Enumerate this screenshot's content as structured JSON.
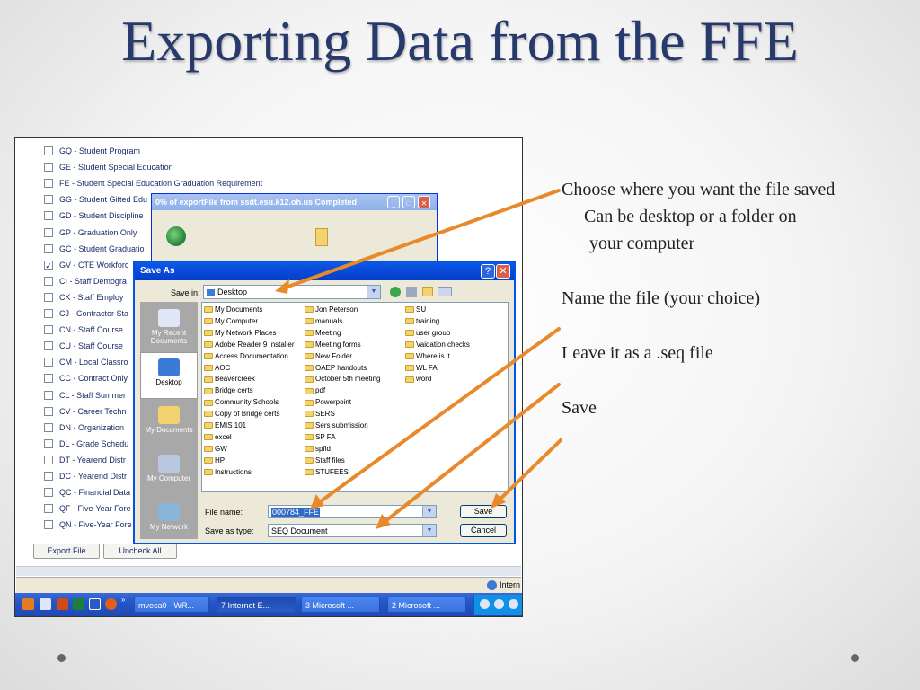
{
  "slide": {
    "title": "Exporting Data from the FFE",
    "bullets": {
      "b1": "Choose where you want the file saved",
      "b1a": "Can be desktop or a folder on",
      "b1b": "your computer",
      "b2": "Name the file (your choice)",
      "b3": "Leave it as a .seq file",
      "b4": "Save"
    },
    "accent_color": "#e8892b"
  },
  "background_list": {
    "items": [
      {
        "label": "GQ - Student Program",
        "checked": false
      },
      {
        "label": "GE - Student Special Education",
        "checked": false
      },
      {
        "label": "FE - Student Special Education Graduation Requirement",
        "checked": false
      },
      {
        "label": "GG - Student Gifted Edu",
        "checked": false
      },
      {
        "label": "GD - Student Discipline",
        "checked": false
      },
      {
        "label": "GP - Graduation Only",
        "checked": false
      },
      {
        "label": "GC - Student Graduatio",
        "checked": false
      },
      {
        "label": "GV - CTE Workforc",
        "checked": true
      },
      {
        "label": "CI - Staff Demogra",
        "checked": false
      },
      {
        "label": "CK - Staff Employ",
        "checked": false
      },
      {
        "label": "CJ - Contractor Sta",
        "checked": false
      },
      {
        "label": "CN - Staff Course",
        "checked": false
      },
      {
        "label": "CU - Staff Course",
        "checked": false
      },
      {
        "label": "CM - Local Classro",
        "checked": false
      },
      {
        "label": "CC - Contract Only",
        "checked": false
      },
      {
        "label": "CL - Staff Summer",
        "checked": false
      },
      {
        "label": "CV - Career Techn",
        "checked": false
      },
      {
        "label": "DN - Organization",
        "checked": false
      },
      {
        "label": "DL - Grade Schedu",
        "checked": false
      },
      {
        "label": "DT - Yearend Distr",
        "checked": false
      },
      {
        "label": "DC - Yearend Distr",
        "checked": false
      },
      {
        "label": "QC - Financial Data",
        "checked": false
      },
      {
        "label": "QF - Five-Year Fore",
        "checked": false
      },
      {
        "label": "QN - Five-Year Fore",
        "checked": false
      }
    ],
    "export_button": "Export File",
    "uncheck_button": "Uncheck All"
  },
  "progress_dialog": {
    "title": "0% of exportFile from ssdt.esu.k12.oh.us Completed"
  },
  "save_dialog": {
    "title": "Save As",
    "save_in_label": "Save in:",
    "save_in_value": "Desktop",
    "places": [
      "My Recent Documents",
      "Desktop",
      "My Documents",
      "My Computer",
      "My Network"
    ],
    "files_col1": [
      "My Documents",
      "My Computer",
      "My Network Places",
      "Adobe Reader 9 Installer",
      "Access Documentation",
      "AOC",
      "Beavercreek",
      "Bridge certs",
      "Community Schools",
      "Copy of Bridge certs",
      "EMIS 101",
      "excel",
      "GW",
      "HP",
      "Instructions"
    ],
    "files_col2": [
      "Jon Peterson",
      "manuals",
      "Meeting",
      "Meeting forms",
      "New Folder",
      "OAEP handouts",
      "October 5th meeting",
      "pdf",
      "Powerpoint",
      "SERS",
      "Sers submission",
      "SP FA",
      "spfld",
      "Staff files",
      "STUFEES"
    ],
    "files_col3": [
      "SU",
      "training",
      "user group",
      "Vaidation checks",
      "Where is it",
      "WL FA",
      "word"
    ],
    "file_name_label": "File name:",
    "file_name_value": "000784_FFE",
    "save_type_label": "Save as type:",
    "save_type_value": "SEQ Document",
    "save_button": "Save",
    "cancel_button": "Cancel"
  },
  "taskbar": {
    "buttons": [
      "mveca0 - WR...",
      "7 Internet E...",
      "3 Microsoft ...",
      "2 Microsoft ..."
    ],
    "tray_text": "Intern"
  }
}
